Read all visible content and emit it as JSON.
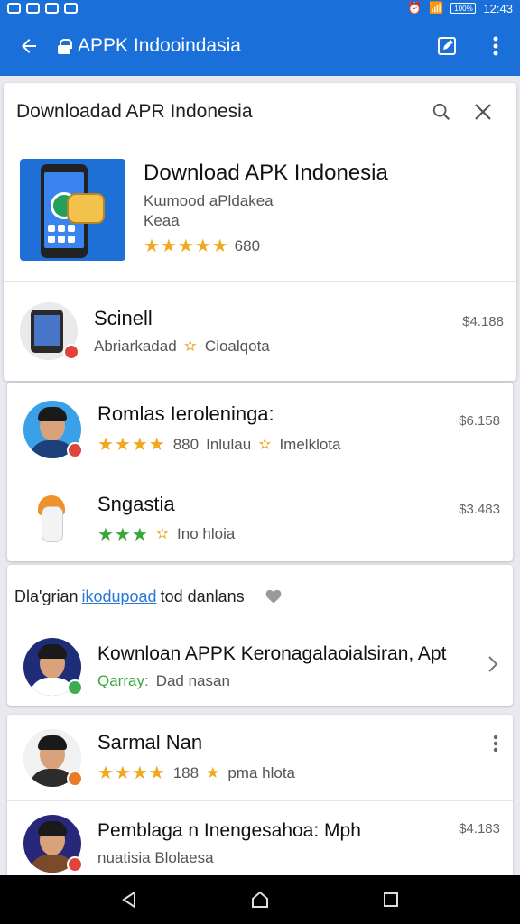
{
  "status_bar": {
    "time": "12:43",
    "battery": "100%"
  },
  "app_bar": {
    "url": "APPK Indooindasia",
    "icons": [
      "back-arrow-icon",
      "lock-icon",
      "edit-icon",
      "more-vert-icon"
    ]
  },
  "search_card": {
    "header_title": "Downloadad APR Indonesia",
    "featured": {
      "title": "Download APK Indonesia",
      "line1": "Kɯmood aPldakea",
      "line2": "Keaa",
      "stars": "★★★★★",
      "rating_count": "680"
    },
    "row": {
      "title": "Scinell",
      "subtitle_left": "Abriarkadad",
      "subtitle_right": "Cioalqota",
      "price": "$4.188"
    }
  },
  "list_card": {
    "rows": [
      {
        "title": "Romlas Ieroleninga:",
        "stars": "★★★★",
        "count": "880",
        "meta": "Inlulau",
        "meta2": "Imelklota",
        "price": "$6.158"
      },
      {
        "title": "Sngastia",
        "stars": "★★★",
        "meta": "Ino hloia",
        "price": "$3.483"
      }
    ]
  },
  "section": {
    "label_pre": "Dla'grian",
    "label_link": "ikodupoad",
    "label_post": "tod danlans"
  },
  "section_card": {
    "title": "Kownloan APPK Keronagalaoialsiran, Apt",
    "sub_accent": "Qarray:",
    "sub_rest": "Dad nasan"
  },
  "bottom_card": {
    "rows": [
      {
        "title": "Sarmal Nan",
        "stars": "★★★★",
        "count": "188",
        "meta": "pma hlota"
      },
      {
        "title": "Pemblaga n Inengesahoa: Mph",
        "meta": "nuatisia Blolaesa",
        "price": "$4.183"
      }
    ]
  },
  "colors": {
    "primary": "#1b6fd8",
    "star": "#f0a81e",
    "link": "#2a78d6"
  }
}
